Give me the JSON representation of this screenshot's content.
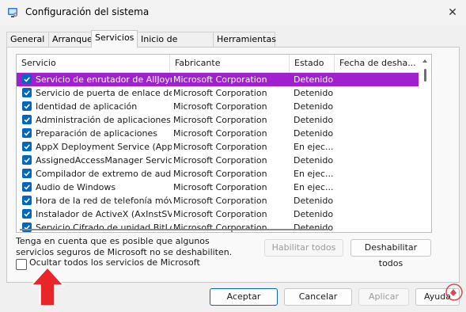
{
  "window": {
    "title": "Configuración del sistema",
    "close_glyph": "✕"
  },
  "tabs": [
    {
      "label": "General"
    },
    {
      "label": "Arranque"
    },
    {
      "label": "Servicios"
    },
    {
      "label": "Inicio de Windows"
    },
    {
      "label": "Herramientas"
    }
  ],
  "active_tab": "Servicios",
  "table": {
    "columns": [
      "Servicio",
      "Fabricante",
      "Estado",
      "Fecha de desha..."
    ],
    "rows": [
      {
        "checked": true,
        "service": "Servicio de enrutador de AllJoyn",
        "maker": "Microsoft Corporation",
        "status": "Detenido"
      },
      {
        "checked": true,
        "service": "Servicio de puerta de enlace de ...",
        "maker": "Microsoft Corporation",
        "status": "Detenido"
      },
      {
        "checked": true,
        "service": "Identidad de aplicación",
        "maker": "Microsoft Corporation",
        "status": "Detenido"
      },
      {
        "checked": true,
        "service": "Administración de aplicaciones",
        "maker": "Microsoft Corporation",
        "status": "Detenido"
      },
      {
        "checked": true,
        "service": "Preparación de aplicaciones",
        "maker": "Microsoft Corporation",
        "status": "Detenido"
      },
      {
        "checked": true,
        "service": "AppX Deployment Service (AppX...",
        "maker": "Microsoft Corporation",
        "status": "En ejec..."
      },
      {
        "checked": true,
        "service": "AssignedAccessManager Service",
        "maker": "Microsoft Corporation",
        "status": "Detenido"
      },
      {
        "checked": true,
        "service": "Compilador de extremo de audio...",
        "maker": "Microsoft Corporation",
        "status": "En ejec..."
      },
      {
        "checked": true,
        "service": "Audio de Windows",
        "maker": "Microsoft Corporation",
        "status": "En ejec..."
      },
      {
        "checked": true,
        "service": "Hora de la red de telefonía móvil",
        "maker": "Microsoft Corporation",
        "status": "Detenido"
      },
      {
        "checked": true,
        "service": "Instalador de ActiveX (AxInstSV)",
        "maker": "Microsoft Corporation",
        "status": "Detenido"
      },
      {
        "checked": true,
        "service": "Servicio Cifrado de unidad BitLoc...",
        "maker": "Microsoft Corporation",
        "status": "Detenido"
      }
    ],
    "selected_row": 0
  },
  "note": "Tenga en cuenta que es posible que algunos servicios seguros de Microsoft no se deshabiliten.",
  "buttons": {
    "enable_all": "Habilitar todos",
    "disable_all": "Deshabilitar todos",
    "ok": "Aceptar",
    "cancel": "Cancelar",
    "apply": "Aplicar",
    "help": "Ayuda"
  },
  "hide_ms": {
    "label": "Ocultar todos los servicios de Microsoft",
    "checked": false
  },
  "colors": {
    "selection": "#a020d0",
    "checkbox": "#0067c0",
    "pointer": "#e8262a"
  }
}
